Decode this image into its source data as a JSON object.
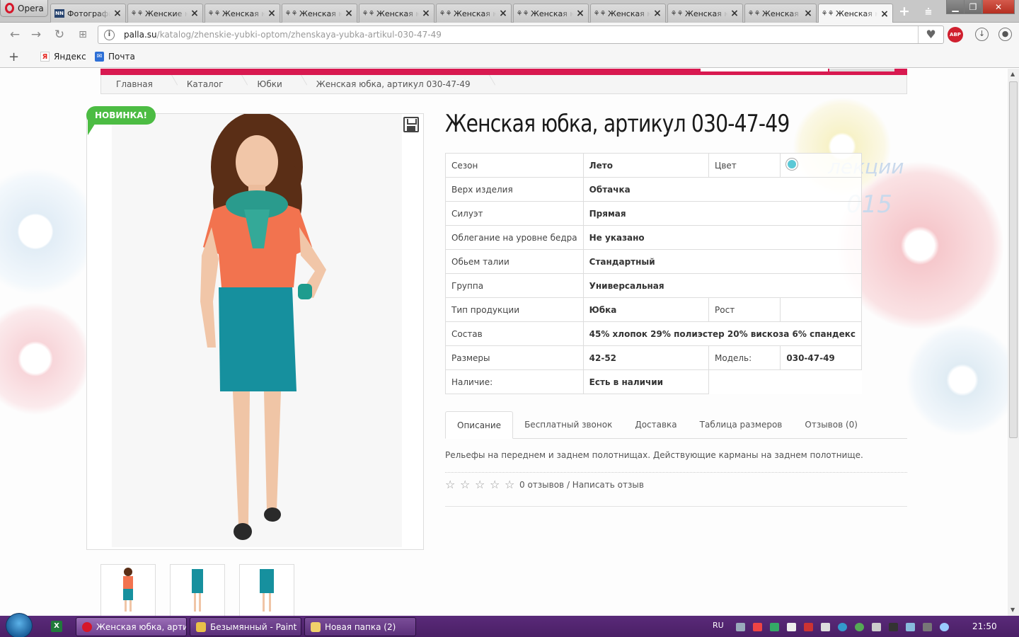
{
  "browser": {
    "menu_label": "Opera",
    "tabs": [
      {
        "title": "Фотография",
        "icon": "nn-logo-icon"
      },
      {
        "title": "Женские юбки",
        "icon": "palla-logo-icon"
      },
      {
        "title": "Женская юбка",
        "icon": "palla-logo-icon"
      },
      {
        "title": "Женская юбка",
        "icon": "palla-logo-icon"
      },
      {
        "title": "Женская юбка",
        "icon": "palla-logo-icon"
      },
      {
        "title": "Женская юбка",
        "icon": "palla-logo-icon"
      },
      {
        "title": "Женская юбка",
        "icon": "palla-logo-icon"
      },
      {
        "title": "Женская юбка",
        "icon": "palla-logo-icon"
      },
      {
        "title": "Женская юбка",
        "icon": "palla-logo-icon"
      },
      {
        "title": "Женская юбка",
        "icon": "palla-logo-icon"
      },
      {
        "title": "Женская юбка",
        "icon": "palla-logo-icon"
      }
    ],
    "url_host": "palla.su",
    "url_path": "/katalog/zhenskie-yubki-optom/zhenskaya-yubka-artikul-030-47-49",
    "abp_label": "ABP",
    "bookmarks": [
      {
        "label": "Яндекс",
        "icon": "yandex-icon"
      },
      {
        "label": "Почта",
        "icon": "mail-icon"
      }
    ]
  },
  "page": {
    "breadcrumbs": [
      "Главная",
      "Каталог",
      "Юбки",
      "Женская юбка, артикул 030-47-49"
    ],
    "badge": "НОВИНКА!",
    "title": "Женская юбка, артикул 030-47-49",
    "background_text_1": "лекции",
    "background_text_2": "015",
    "specs": {
      "season_label": "Сезон",
      "season": "Лето",
      "color_label": "Цвет",
      "color_swatch": "#5bc8d6",
      "top_label": "Верх изделия",
      "top": "Обтачка",
      "silhouette_label": "Силуэт",
      "silhouette": "Прямая",
      "hip_label": "Облегание на уровне бедра",
      "hip": "Не указано",
      "waist_label": "Обьем талии",
      "waist": "Стандартный",
      "group_label": "Группа",
      "group": "Универсальная",
      "type_label": "Тип продукции",
      "type": "Юбка",
      "height_label": "Рост",
      "height": "",
      "composition_label": "Состав",
      "composition": "45% хлопок 29% полиэстер 20% вискоза 6% спандекс",
      "sizes_label": "Размеры",
      "sizes": "42-52",
      "model_label": "Модель:",
      "model": "030-47-49",
      "availability_label": "Наличие:",
      "availability": "Есть в наличии"
    },
    "tabs": [
      "Описание",
      "Бесплатный звонок",
      "Доставка",
      "Таблица размеров",
      "Отзывов (0)"
    ],
    "description": "Рельефы на переднем и заднем полотнищах. Действующие карманы на заднем полотнище.",
    "rating": {
      "stars": 0,
      "max": 5,
      "text": "0 отзывов / Написать отзыв"
    },
    "accent_color": "#d81950",
    "badge_color": "#4cbc43"
  },
  "taskbar": {
    "items": [
      {
        "label": "Женская юбка, артик..."
      },
      {
        "label": "Безымянный - Paint"
      },
      {
        "label": "Новая папка (2)"
      }
    ],
    "language": "RU",
    "clock": "21:50"
  }
}
